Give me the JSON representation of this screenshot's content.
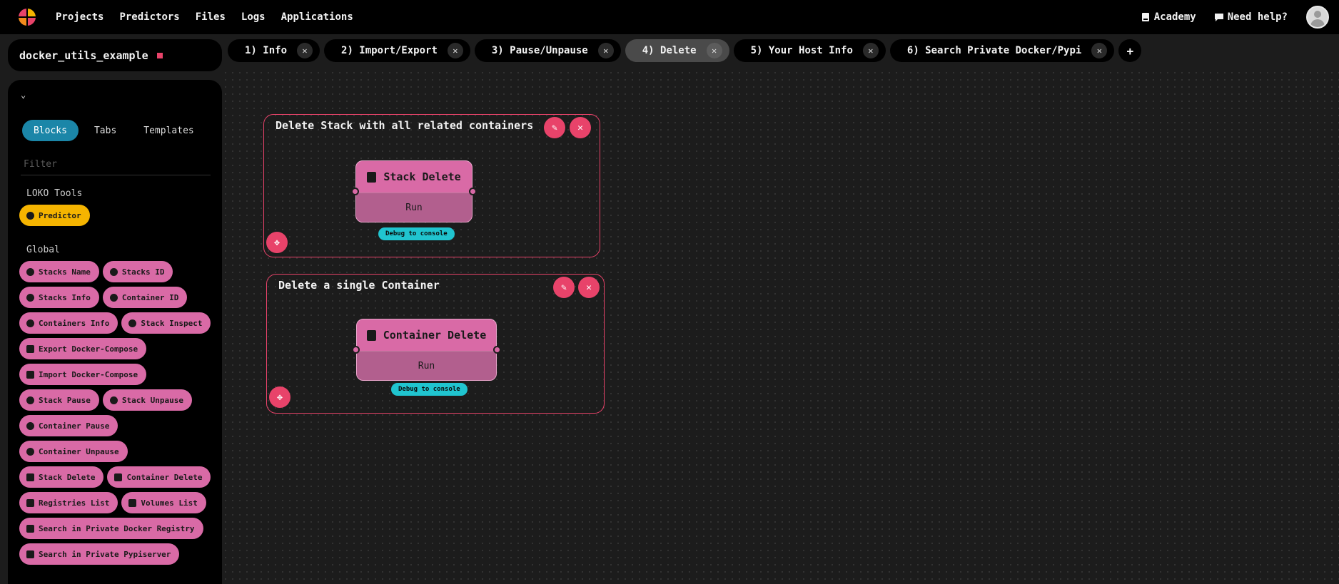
{
  "nav": {
    "items": [
      "Projects",
      "Predictors",
      "Files",
      "Logs",
      "Applications"
    ],
    "academy": "Academy",
    "help": "Need help?"
  },
  "project": {
    "name": "docker_utils_example"
  },
  "tabs": [
    {
      "label": "1) Info",
      "active": false
    },
    {
      "label": "2) Import/Export",
      "active": false
    },
    {
      "label": "3) Pause/Unpause",
      "active": false
    },
    {
      "label": "4) Delete",
      "active": true
    },
    {
      "label": "5) Your Host Info",
      "active": false
    },
    {
      "label": "6) Search Private Docker/Pypi",
      "active": false
    }
  ],
  "sidebar": {
    "tabs": [
      "Blocks",
      "Tabs",
      "Templates"
    ],
    "filter_placeholder": "Filter",
    "loko_title": "LOKO Tools",
    "loko_items": [
      "Predictor"
    ],
    "global_title": "Global",
    "global_items": [
      "Stacks Name",
      "Stacks ID",
      "Stacks Info",
      "Container ID",
      "Containers Info",
      "Stack Inspect",
      "Export Docker-Compose",
      "Import Docker-Compose",
      "Stack Pause",
      "Stack Unpause",
      "Container Pause",
      "Container Unpause",
      "Stack Delete",
      "Container Delete",
      "Registries List",
      "Volumes List",
      "Search in Private Docker Registry",
      "Search in Private Pypiserver"
    ]
  },
  "canvas": {
    "group1": {
      "title": "Delete Stack with all related containers",
      "block": {
        "title": "Stack Delete",
        "run": "Run",
        "debug": "Debug to console"
      }
    },
    "group2": {
      "title": "Delete a single Container",
      "block": {
        "title": "Container Delete",
        "run": "Run",
        "debug": "Debug to console"
      }
    }
  },
  "colors": {
    "accent": "#e8436a",
    "block": "#d96aa6",
    "tab_active": "#1b86a8",
    "predictor": "#f5b400",
    "debug": "#20c4cf"
  }
}
